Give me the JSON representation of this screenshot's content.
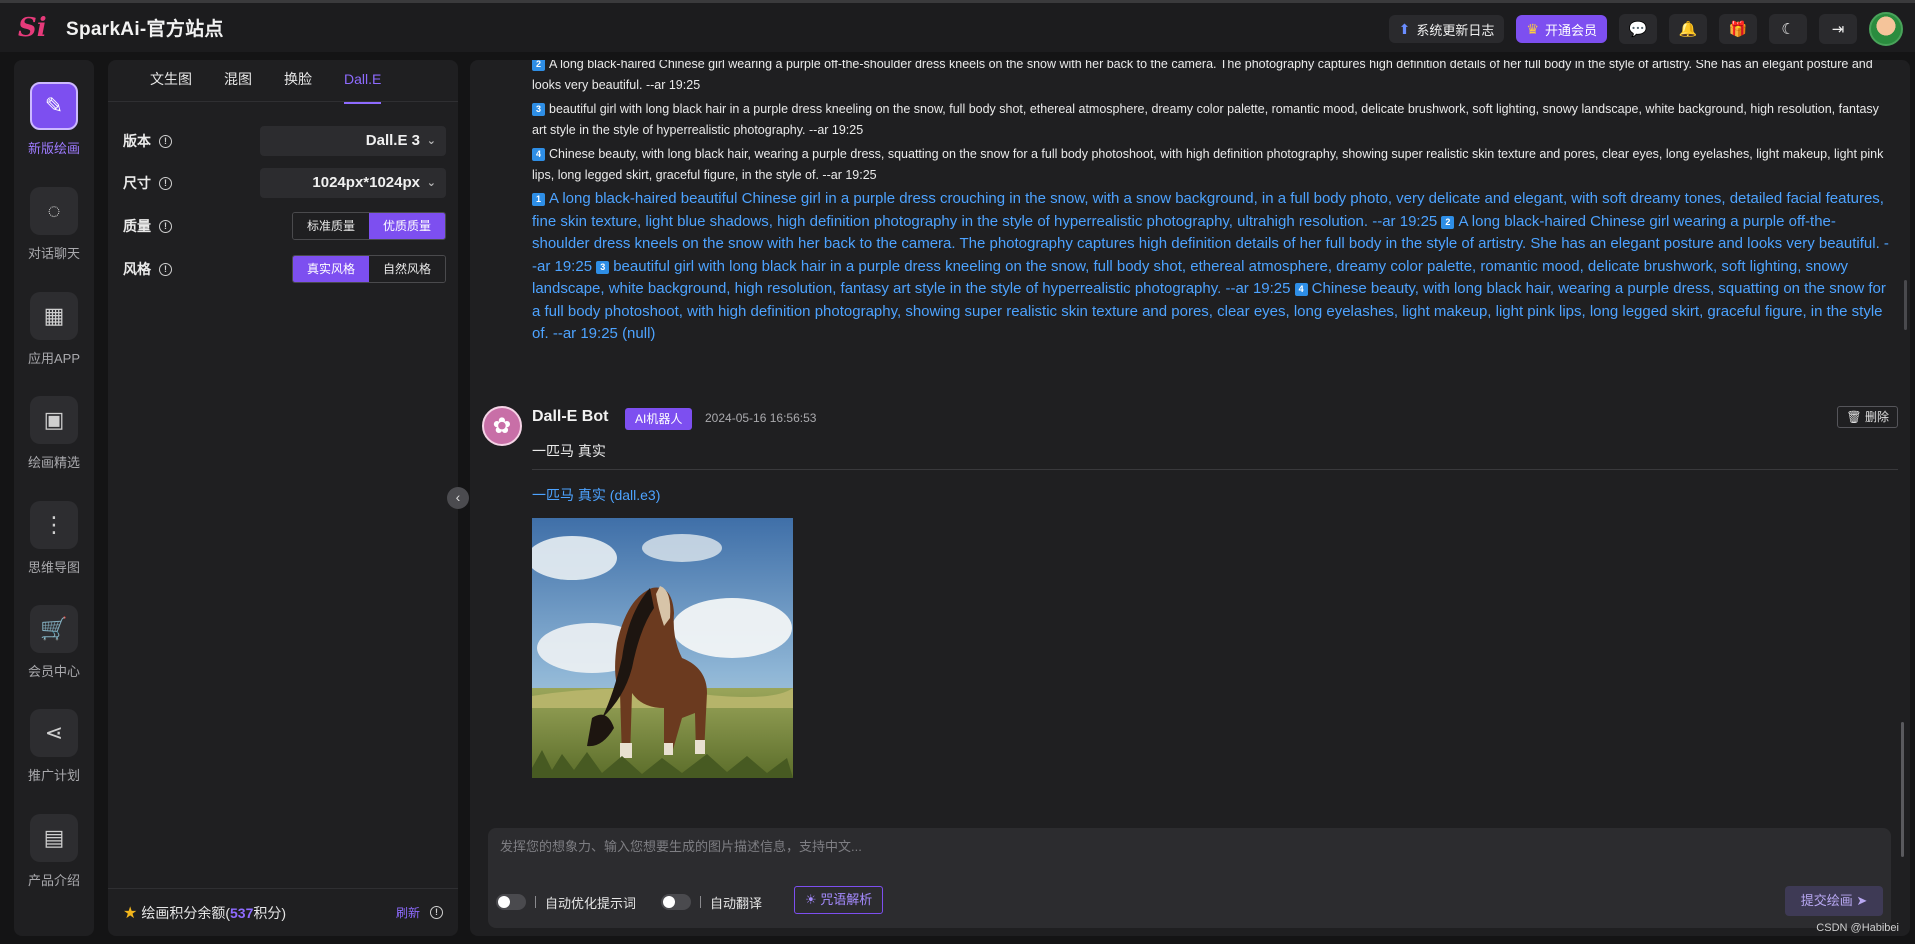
{
  "app": {
    "brand": "SparkAi-官方站点",
    "logo_text": "Si"
  },
  "topbar": {
    "changelog": "系统更新日志",
    "vip": "开通会员"
  },
  "rail": {
    "items": [
      {
        "label": "新版绘画",
        "icon": "paint-icon"
      },
      {
        "label": "对话聊天",
        "icon": "chat-icon"
      },
      {
        "label": "应用APP",
        "icon": "apps-icon"
      },
      {
        "label": "绘画精选",
        "icon": "gallery-icon"
      },
      {
        "label": "思维导图",
        "icon": "mindmap-icon"
      },
      {
        "label": "会员中心",
        "icon": "cart-icon"
      },
      {
        "label": "推广计划",
        "icon": "share-icon"
      },
      {
        "label": "产品介绍",
        "icon": "product-icon"
      }
    ]
  },
  "panel": {
    "tabs": [
      "文生图",
      "混图",
      "换脸",
      "Dall.E"
    ],
    "version_label": "版本",
    "version_value": "Dall.E 3",
    "size_label": "尺寸",
    "size_value": "1024px*1024px",
    "quality_label": "质量",
    "quality_options": [
      "标准质量",
      "优质质量"
    ],
    "style_label": "风格",
    "style_options": [
      "真实风格",
      "自然风格"
    ],
    "credits_prefix": "绘画积分余额(",
    "credits_value": "537",
    "credits_suffix": "积分)",
    "refresh": "刷新"
  },
  "previous": {
    "line1": "A long black-haired Chinese girl wearing a purple off-the-shoulder dress kneels on the snow with her back to the camera. The photography captures high definition details of her full body in the style of artistry. She has an elegant posture and looks very beautiful. --ar 19:25",
    "line1_num": "2",
    "line3": "beautiful girl with long black hair in a purple dress kneeling on the snow, full body shot, ethereal atmosphere, dreamy color palette, romantic mood, delicate brushwork, soft lighting, snowy landscape, white background, high resolution, fantasy art style in the style of hyperrealistic photography. --ar 19:25",
    "line3_num": "3",
    "line4": "Chinese beauty, with long black hair, wearing a purple dress, squatting on the snow for a full body photoshoot, with high definition photography, showing super realistic skin texture and pores, clear eyes, long eyelashes, light makeup, light pink lips, long legged skirt, graceful figure, in the style of. --ar 19:25",
    "line4_num": "4",
    "prompt_blue": {
      "p1": "A long black-haired beautiful Chinese girl in a purple dress crouching in the snow, with a snow background, in a full body photo, very delicate and elegant, with soft dreamy tones, detailed facial features, fine skin texture, light blue shadows, high definition photography in the style of hyperrealistic photography, ultrahigh resolution. --ar 19:25",
      "p2": "A long black-haired Chinese girl wearing a purple off-the-shoulder dress kneels on the snow with her back to the camera. The photography captures high definition details of her full body in the style of artistry. She has an elegant posture and looks very beautiful. --ar 19:25",
      "p3": "beautiful girl with long black hair in a purple dress kneeling on the snow, full body shot, ethereal atmosphere, dreamy color palette, romantic mood, delicate brushwork, soft lighting, snowy landscape, white background, high resolution, fantasy art style in the style of hyperrealistic photography. --ar 19:25",
      "p4": "Chinese beauty, with long black hair, wearing a purple dress, squatting on the snow for a full body photoshoot, with high definition photography, showing super realistic skin texture and pores, clear eyes, long eyelashes, light makeup, light pink lips, long legged skirt, graceful figure, in the style of. --ar 19:25",
      "tail": "(null)",
      "n1": "1",
      "n2": "2",
      "n3": "3",
      "n4": "4"
    }
  },
  "message": {
    "bot_name": "Dall-E Bot",
    "tag": "AI机器人",
    "time": "2024-05-16 16:56:53",
    "delete": "删除",
    "text": "一匹马 真实",
    "link": "一匹马 真实 (dall.e3)"
  },
  "composer": {
    "placeholder": "发挥您的想象力、输入您想要生成的图片描述信息，支持中文...",
    "auto_optimize": "自动优化提示词",
    "auto_translate": "自动翻译",
    "spell": "咒语解析",
    "submit": "提交绘画"
  },
  "watermark": "CSDN @Habibei",
  "colors": {
    "accent": "#7d4ff0",
    "link": "#4da3ff",
    "bg": "#141415",
    "panel": "#1f1f21"
  }
}
